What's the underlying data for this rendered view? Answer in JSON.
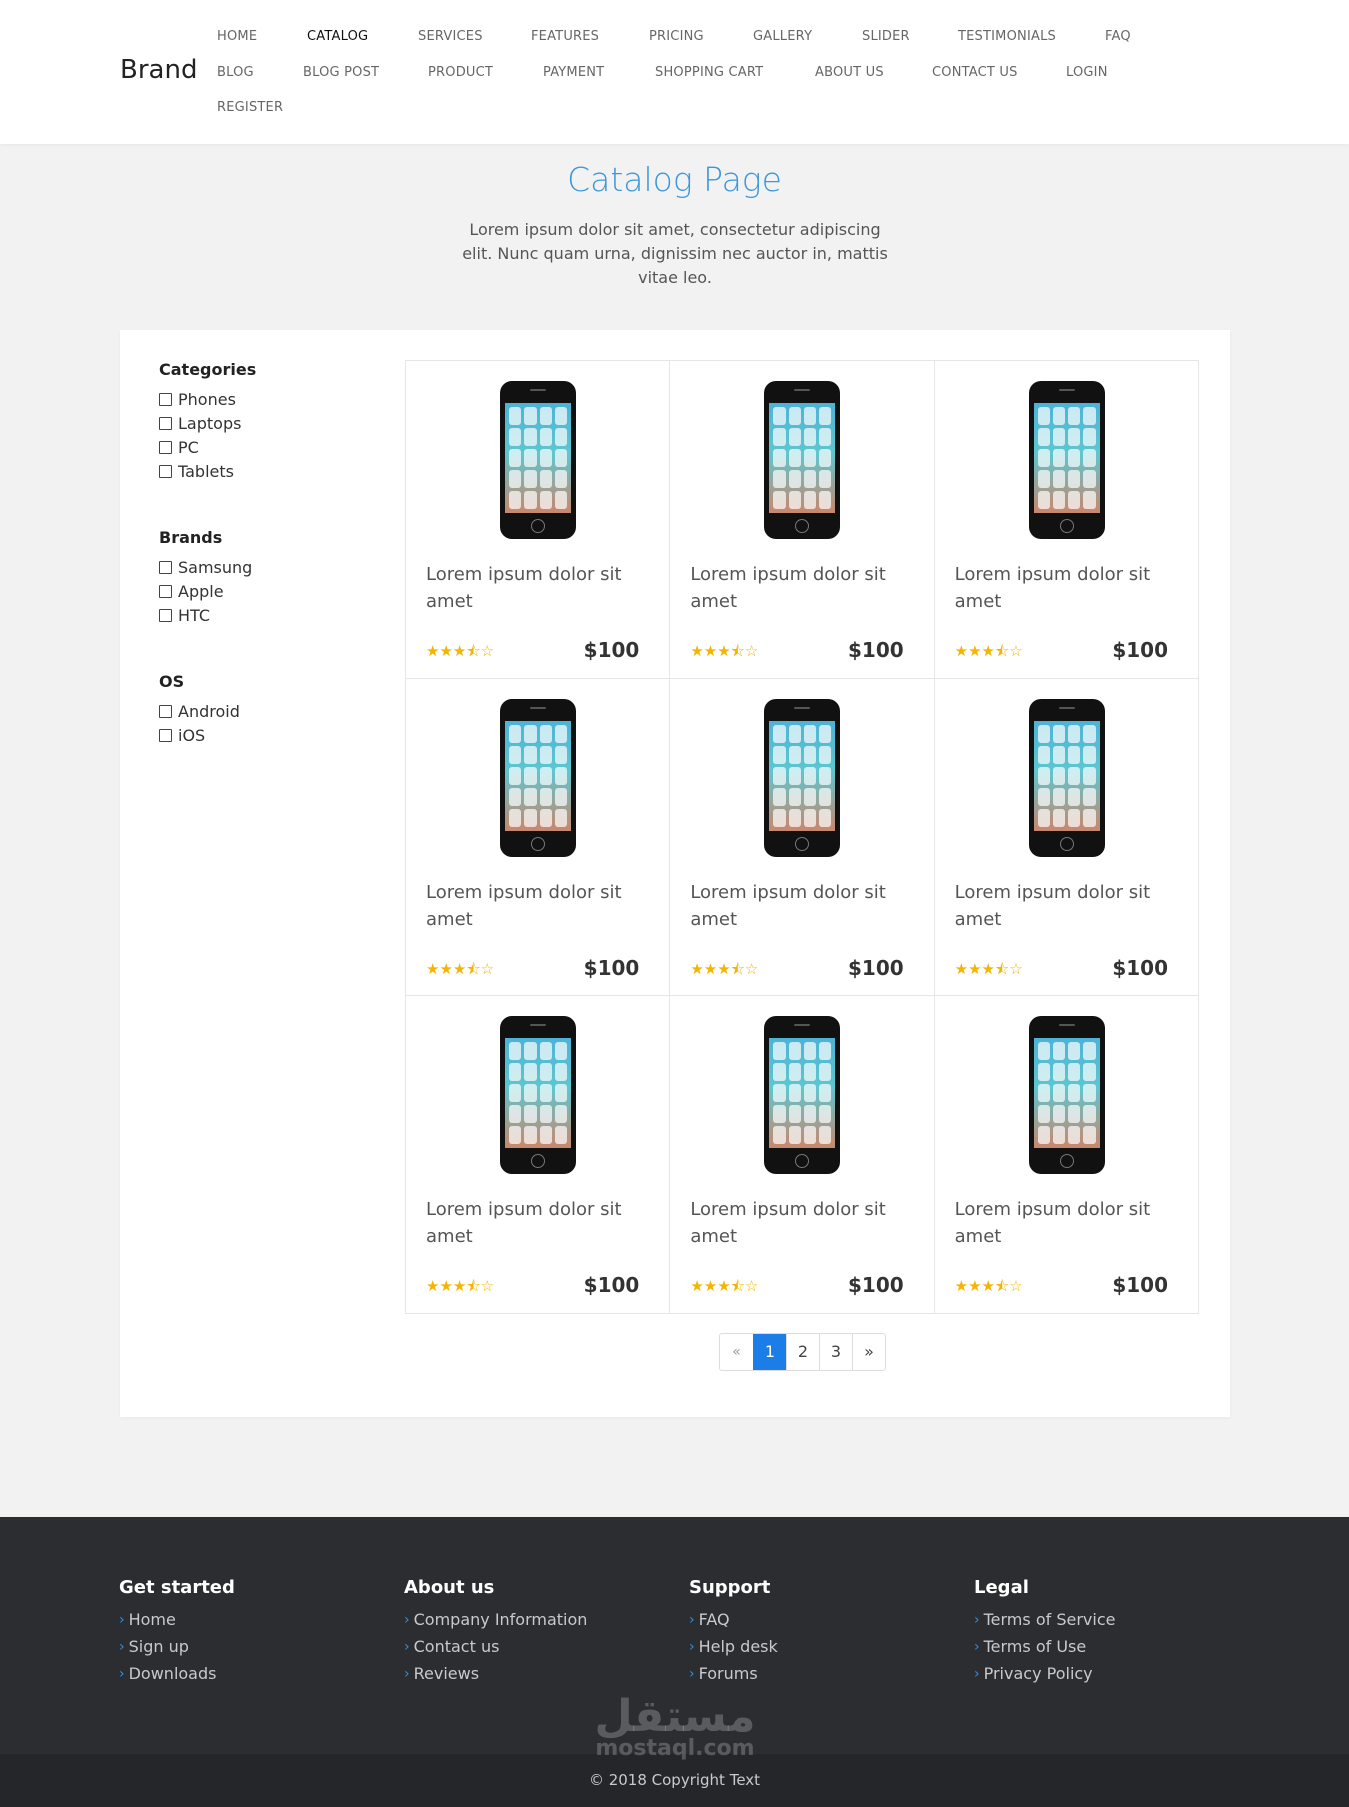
{
  "brand": "Brand",
  "nav": {
    "items": [
      {
        "label": "HOME"
      },
      {
        "label": "CATALOG",
        "active": true
      },
      {
        "label": "SERVICES"
      },
      {
        "label": "FEATURES"
      },
      {
        "label": "PRICING"
      },
      {
        "label": "GALLERY"
      },
      {
        "label": "SLIDER"
      },
      {
        "label": "TESTIMONIALS"
      },
      {
        "label": "FAQ"
      },
      {
        "label": "BLOG"
      },
      {
        "label": "BLOG POST"
      },
      {
        "label": "PRODUCT"
      },
      {
        "label": "PAYMENT"
      },
      {
        "label": "SHOPPING CART"
      },
      {
        "label": "ABOUT US"
      },
      {
        "label": "CONTACT US"
      },
      {
        "label": "LOGIN"
      },
      {
        "label": "REGISTER"
      }
    ]
  },
  "intro": {
    "title": "Catalog Page",
    "description": "Lorem ipsum dolor sit amet, consectetur adipiscing elit. Nunc quam urna, dignissim nec auctor in, mattis vitae leo."
  },
  "filters": [
    {
      "title": "Categories",
      "options": [
        "Phones",
        "Laptops",
        "PC",
        "Tablets"
      ]
    },
    {
      "title": "Brands",
      "options": [
        "Samsung",
        "Apple",
        "HTC"
      ]
    },
    {
      "title": "OS",
      "options": [
        "Android",
        "iOS"
      ]
    }
  ],
  "products": [
    {
      "title": "Lorem ipsum dolor sit amet",
      "price": "$100",
      "rating": 3.5,
      "image": "smartphone-image"
    },
    {
      "title": "Lorem ipsum dolor sit amet",
      "price": "$100",
      "rating": 3.5,
      "image": "smartphone-image"
    },
    {
      "title": "Lorem ipsum dolor sit amet",
      "price": "$100",
      "rating": 3.5,
      "image": "smartphone-image"
    },
    {
      "title": "Lorem ipsum dolor sit amet",
      "price": "$100",
      "rating": 3.5,
      "image": "smartphone-image"
    },
    {
      "title": "Lorem ipsum dolor sit amet",
      "price": "$100",
      "rating": 3.5,
      "image": "smartphone-image"
    },
    {
      "title": "Lorem ipsum dolor sit amet",
      "price": "$100",
      "rating": 3.5,
      "image": "smartphone-image"
    },
    {
      "title": "Lorem ipsum dolor sit amet",
      "price": "$100",
      "rating": 3.5,
      "image": "smartphone-image"
    },
    {
      "title": "Lorem ipsum dolor sit amet",
      "price": "$100",
      "rating": 3.5,
      "image": "smartphone-image"
    },
    {
      "title": "Lorem ipsum dolor sit amet",
      "price": "$100",
      "rating": 3.5,
      "image": "smartphone-image"
    }
  ],
  "pagination": {
    "prev": "«",
    "pages": [
      "1",
      "2",
      "3"
    ],
    "current": "1",
    "next": "»"
  },
  "footer": {
    "columns": [
      {
        "title": "Get started",
        "links": [
          "Home",
          "Sign up",
          "Downloads"
        ]
      },
      {
        "title": "About us",
        "links": [
          "Company Information",
          "Contact us",
          "Reviews"
        ]
      },
      {
        "title": "Support",
        "links": [
          "FAQ",
          "Help desk",
          "Forums"
        ]
      },
      {
        "title": "Legal",
        "links": [
          "Terms of Service",
          "Terms of Use",
          "Privacy Policy"
        ]
      }
    ],
    "copyright": "© 2018 Copyright Text"
  },
  "watermark": {
    "arabic": "مستقل",
    "latin": "mostaql.com"
  },
  "colors": {
    "accent": "#3b98d9",
    "star": "#f4b400",
    "pager_active": "#1a7de8",
    "footer_bg": "#2b2d31"
  }
}
